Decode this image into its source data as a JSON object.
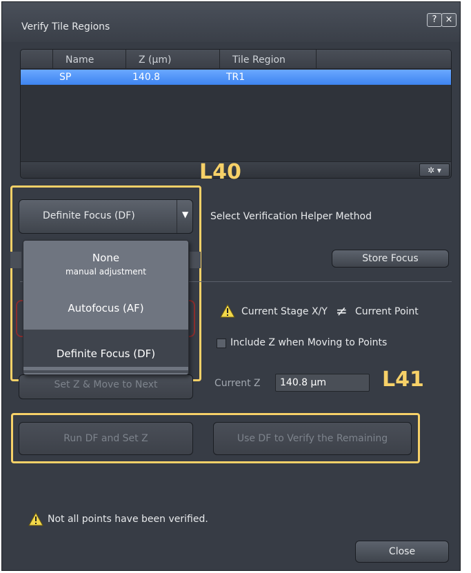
{
  "dialog": {
    "title": "Verify Tile Regions",
    "help_glyph": "?",
    "close_glyph": "×"
  },
  "table": {
    "columns": [
      "Name",
      "Z (µm)",
      "Tile Region"
    ],
    "rows": [
      {
        "name": "SP",
        "z": "140.8",
        "tile_region": "TR1"
      }
    ],
    "options_glyph": "✲ ▾"
  },
  "helper": {
    "selected": "Definite Focus (DF)",
    "label": "Select Verification Helper Method",
    "options": [
      {
        "label": "None",
        "sublabel": "manual adjustment"
      },
      {
        "label": "Autofocus (AF)"
      },
      {
        "label": "Definite Focus (DF)"
      }
    ],
    "store_focus": "Store Focus"
  },
  "stage": {
    "current_stage": "Current Stage X/Y",
    "not_equal": "≠",
    "current_point": "Current Point",
    "include_z": "Include Z when Moving to Points",
    "current_z_label": "Current Z",
    "current_z_value": "140.8 µm",
    "set_z_move_next": "Set Z & Move to Next"
  },
  "actions": {
    "run_df": "Run DF and Set Z",
    "use_df": "Use DF to Verify the Remaining"
  },
  "annotations": {
    "l40": "L40",
    "l41": "L41",
    "color": "#f7d168"
  },
  "status": {
    "message": "Not all points have been verified."
  },
  "footer": {
    "close": "Close"
  },
  "colors": {
    "selection": "#4a8ff5",
    "dialog_bg": "#373c45"
  }
}
